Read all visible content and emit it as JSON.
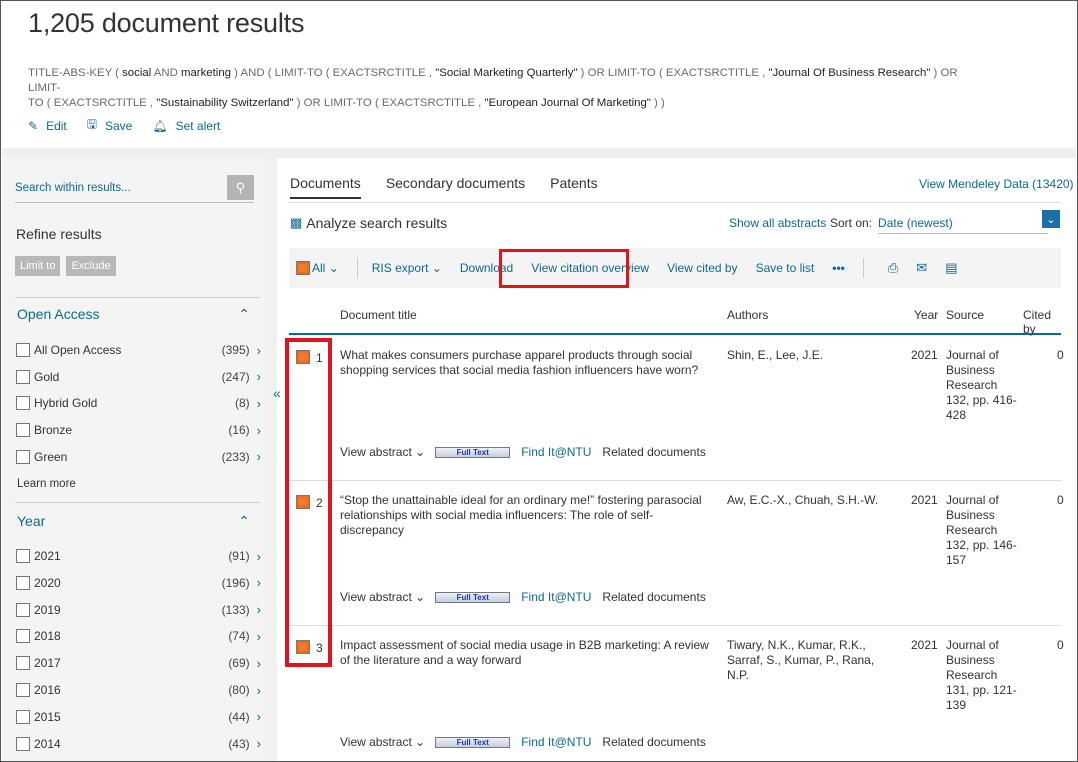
{
  "header": {
    "title": "1,205 document results",
    "query_line1": [
      {
        "t": "TITLE-ABS-KEY ( ",
        "b": false
      },
      {
        "t": "social",
        "b": true
      },
      {
        "t": "  AND  ",
        "b": false
      },
      {
        "t": "marketing",
        "b": true
      },
      {
        "t": " )  AND  ( LIMIT-TO ( EXACTSRCTITLE ,  ",
        "b": false
      },
      {
        "t": "\"Social Marketing Quarterly\"",
        "b": true
      },
      {
        "t": " )  OR  LIMIT-TO ( EXACTSRCTITLE ,  ",
        "b": false
      },
      {
        "t": "\"Journal Of Business Research\"",
        "b": true
      },
      {
        "t": " )  OR  LIMIT-",
        "b": false
      }
    ],
    "query_line2": [
      {
        "t": "TO ( EXACTSRCTITLE ,  ",
        "b": false
      },
      {
        "t": "\"Sustainability Switzerland\"",
        "b": true
      },
      {
        "t": " )  OR  LIMIT-TO ( EXACTSRCTITLE ,  ",
        "b": false
      },
      {
        "t": "\"European Journal Of Marketing\"",
        "b": true
      },
      {
        "t": " ) )",
        "b": false
      }
    ],
    "actions": {
      "edit": "Edit",
      "save": "Save",
      "set_alert": "Set alert"
    }
  },
  "sidebar": {
    "search_placeholder": "Search within results...",
    "refine": "Refine results",
    "limit_to": "Limit to",
    "exclude": "Exclude",
    "open_access": {
      "heading": "Open Access",
      "items": [
        {
          "label": "All Open Access",
          "count": "(395)"
        },
        {
          "label": "Gold",
          "count": "(247)"
        },
        {
          "label": "Hybrid Gold",
          "count": "(8)"
        },
        {
          "label": "Bronze",
          "count": "(16)"
        },
        {
          "label": "Green",
          "count": "(233)"
        }
      ],
      "learn_more": "Learn more"
    },
    "year": {
      "heading": "Year",
      "items": [
        {
          "label": "2021",
          "count": "(91)"
        },
        {
          "label": "2020",
          "count": "(196)"
        },
        {
          "label": "2019",
          "count": "(133)"
        },
        {
          "label": "2018",
          "count": "(74)"
        },
        {
          "label": "2017",
          "count": "(69)"
        },
        {
          "label": "2016",
          "count": "(80)"
        },
        {
          "label": "2015",
          "count": "(44)"
        },
        {
          "label": "2014",
          "count": "(43)"
        }
      ]
    }
  },
  "main": {
    "tabs": [
      "Documents",
      "Secondary documents",
      "Patents"
    ],
    "mendeley": "View Mendeley Data (13420)",
    "analyze": "Analyze search results",
    "show_all_abstracts": "Show all abstracts",
    "sort_label": "Sort on:",
    "sort_value": "Date (newest)",
    "toolbar": {
      "all": "All",
      "ris_export": "RIS export",
      "download": "Download",
      "view_citation_overview": "View citation overview",
      "view_cited_by": "View cited by",
      "save_to_list": "Save to list",
      "more": "•••"
    },
    "columns": {
      "title": "Document title",
      "authors": "Authors",
      "year": "Year",
      "source": "Source",
      "cited_by": "Cited by"
    },
    "rows": [
      {
        "num": "1",
        "title": "What makes consumers purchase apparel products through social shopping services that social media fashion influencers have worn?",
        "authors": "Shin, E., Lee, J.E.",
        "year": "2021",
        "source": "Journal of Business Research 132, pp. 416-428",
        "cited": "0"
      },
      {
        "num": "2",
        "title": "“Stop the unattainable ideal for an ordinary me!” fostering parasocial relationships with social media influencers: The role of self-discrepancy",
        "authors": "Aw, E.C.-X., Chuah, S.H.-W.",
        "year": "2021",
        "source": "Journal of Business Research 132, pp. 146-157",
        "cited": "0"
      },
      {
        "num": "3",
        "title": "Impact assessment of social media usage in B2B marketing: A review of the literature and a way forward",
        "authors": "Tiwary, N.K., Kumar, R.K., Sarraf, S., Kumar, P., Rana, N.P.",
        "year": "2021",
        "source": "Journal of Business Research 131, pp. 121-139",
        "cited": "0"
      }
    ],
    "row_links": {
      "view_abstract": "View abstract",
      "full_text": "Full Text",
      "find_it": "Find It@NTU",
      "related": "Related documents"
    }
  }
}
